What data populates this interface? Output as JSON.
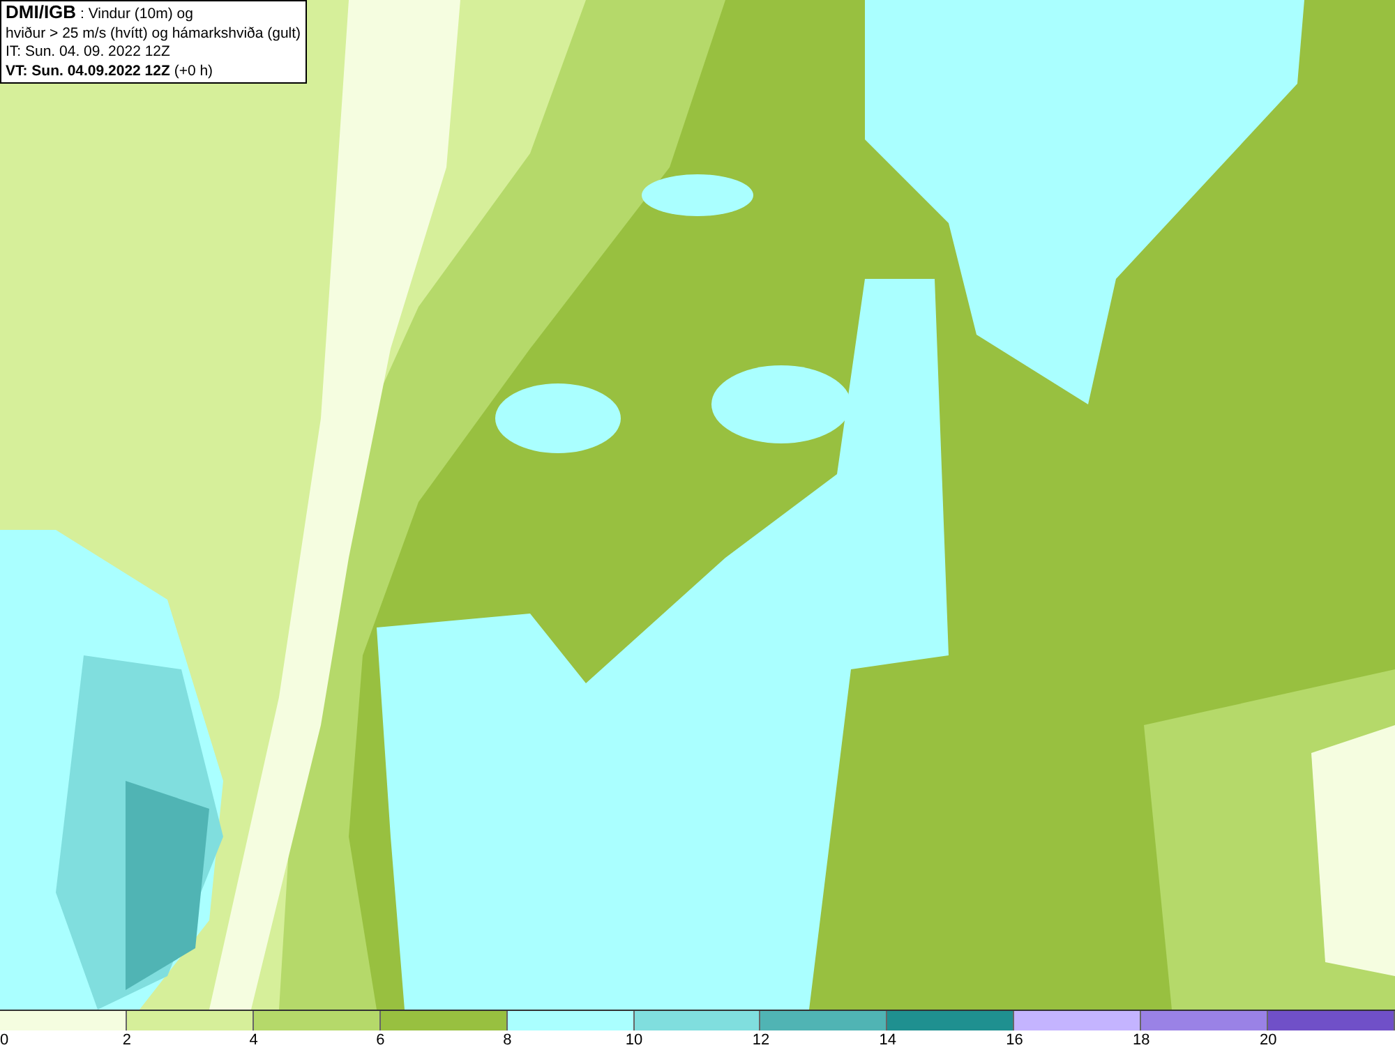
{
  "info_box": {
    "lines": [
      "**DMI/IGB** : Vindur (10m) og",
      "hviður > 25 m/s (hvítt) og hámarkshviða (gult)",
      "IT: Sun. 04. 09. 2022 12Z",
      "**VT: Sun. 04.09.2022 12Z** (+0 h)"
    ]
  },
  "legend": {
    "bins": [
      {
        "color": "#f5fde0"
      },
      {
        "color": "#d6ef9a"
      },
      {
        "color": "#b5d96a"
      },
      {
        "color": "#98c040"
      },
      {
        "color": "#aaffff"
      },
      {
        "color": "#80dede"
      },
      {
        "color": "#50b4b4"
      },
      {
        "color": "#1f9090"
      },
      {
        "color": "#c4b4ff"
      },
      {
        "color": "#9a82e6"
      },
      {
        "color": "#7050c8"
      }
    ],
    "ticks": [
      "0",
      "2",
      "4",
      "6",
      "8",
      "10",
      "12",
      "14",
      "16",
      "18",
      "20"
    ]
  }
}
